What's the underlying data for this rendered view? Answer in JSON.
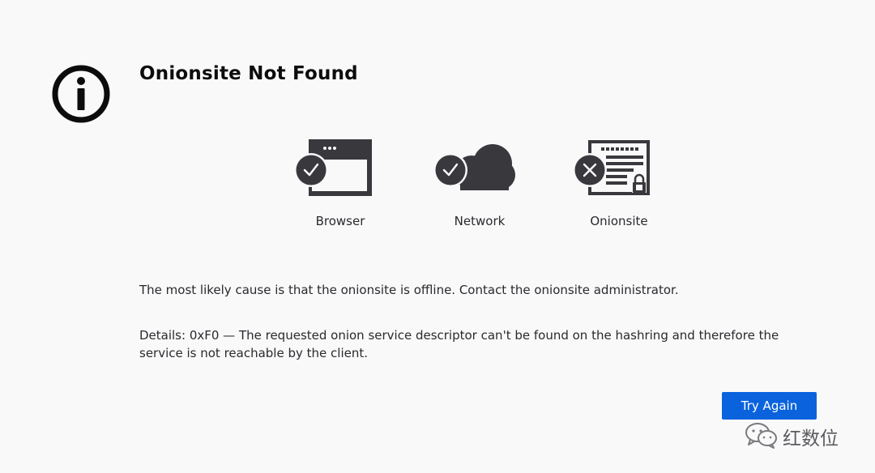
{
  "header": {
    "title": "Onionsite Not Found"
  },
  "connection_steps": [
    {
      "label": "Browser",
      "status": "ok",
      "icon": "browser-window-icon"
    },
    {
      "label": "Network",
      "status": "ok",
      "icon": "cloud-icon"
    },
    {
      "label": "Onionsite",
      "status": "error",
      "icon": "onionsite-server-icon"
    }
  ],
  "message": {
    "cause": "The most likely cause is that the onionsite is offline. Contact the onionsite administrator.",
    "details": "Details: 0xF0 — The requested onion service descriptor can't be found on the hashring and therefore the service is not reachable by the client."
  },
  "actions": {
    "try_again_label": "Try Again"
  },
  "watermark": {
    "text": "红数位"
  },
  "colors": {
    "background": "#f9f9fa",
    "icon_dark": "#38383d",
    "button_blue": "#0a63dd"
  }
}
